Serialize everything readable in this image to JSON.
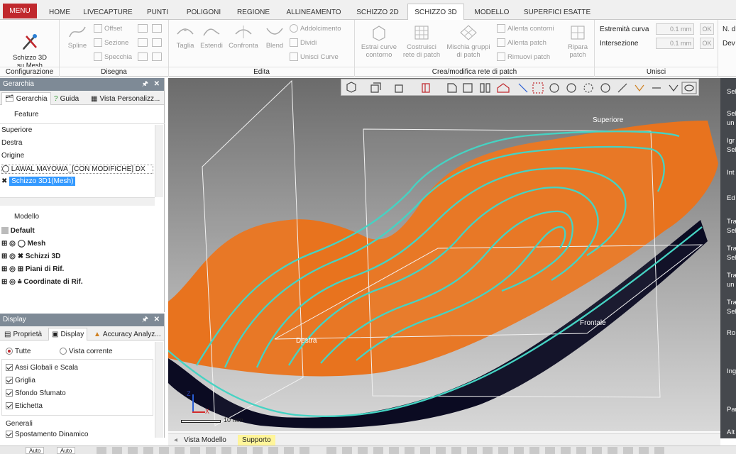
{
  "tabs": {
    "menu": "MENU",
    "items": [
      "HOME",
      "LIVECAPTURE",
      "PUNTI",
      "POLIGONI",
      "REGIONE",
      "ALLINEAMENTO",
      "SCHIZZO 2D",
      "SCHIZZO 3D",
      "MODELLO",
      "SUPERFICI ESATTE"
    ],
    "active": "SCHIZZO 3D"
  },
  "ribbon": {
    "configurazione": {
      "label": "Configurazione",
      "big_button": "Schizzo 3D\nsu Mesh"
    },
    "disegna": {
      "label": "Disegna",
      "spline": "Spline",
      "offset": "Offset",
      "sezione": "Sezione",
      "specchia": "Specchia"
    },
    "edita": {
      "label": "Edita",
      "taglia": "Taglia",
      "estendi": "Estendi",
      "confronta": "Confronta",
      "blend": "Blend",
      "addolcimento": "Addolcimento",
      "dividi": "Dividi",
      "unisci_curve": "Unisci Curve"
    },
    "crea": {
      "label": "Crea/modifica rete di patch",
      "estrai": "Estrai curve\ncontorno",
      "costruisci": "Costruisci\nrete di patch",
      "mischia": "Mischia gruppi\ndi patch",
      "allenta_contorni": "Allenta contorni",
      "allenta_patch": "Allenta patch",
      "rimuovi_patch": "Rimuovi patch",
      "ripara": "Ripara\npatch"
    },
    "unisci": {
      "label": "Unisci",
      "estremita": "Estremità curva",
      "estremita_val": "0.1 mm",
      "intersezione": "Intersezione",
      "intersezione_val": "0.1 mm",
      "ok": "OK",
      "n": "N. d",
      "dev": "Dev"
    }
  },
  "hierarchy": {
    "title": "Gerarchia",
    "tabs": [
      "Gerarchia",
      "Guida",
      "Vista Personalizz..."
    ],
    "feature_header": "Feature",
    "features": [
      "Superiore",
      "Destra",
      "Origine",
      "LAWAL MAYOWA_[CON MODIFICHE] DX",
      "Schizzo 3D1(Mesh)"
    ],
    "model_header": "Modello",
    "default": "Default",
    "model_items": [
      "Mesh",
      "Schizzi 3D",
      "Piani di Rif.",
      "Coordinate di Rif."
    ]
  },
  "display": {
    "title": "Display",
    "tabs": [
      "Proprietà",
      "Display",
      "Accuracy Analyz..."
    ],
    "radio_all": "Tutte",
    "radio_current": "Vista corrente",
    "options": [
      "Assi Globali e Scala",
      "Griglia",
      "Sfondo Sfumato",
      "Etichetta"
    ],
    "general": "Generali",
    "general_item": "Spostamento Dinamico"
  },
  "viewport": {
    "plane_top": "Superiore",
    "plane_right": "Destra",
    "plane_front": "Frontale",
    "scale": "10 mm",
    "axis_x": "X",
    "axis_z": "Z"
  },
  "right_panel": [
    "Sel",
    "Sel\nun",
    "Igr\nSel",
    "Int",
    "Ed",
    "Tra\nSel",
    "Tra\nSel",
    "Tra\nun",
    "Tra\nSel",
    "Ro",
    "Ing",
    "Par",
    "Alt"
  ],
  "view_tabs": [
    "Vista Modello",
    "Supporto"
  ],
  "status": {
    "auto1": "Auto",
    "auto2": "Auto"
  },
  "colors": {
    "accent": "#c0282d",
    "mesh": "#e8731e",
    "curve": "#45d3c3",
    "selection": "#3399ff",
    "panel_title": "#7e8a96"
  }
}
